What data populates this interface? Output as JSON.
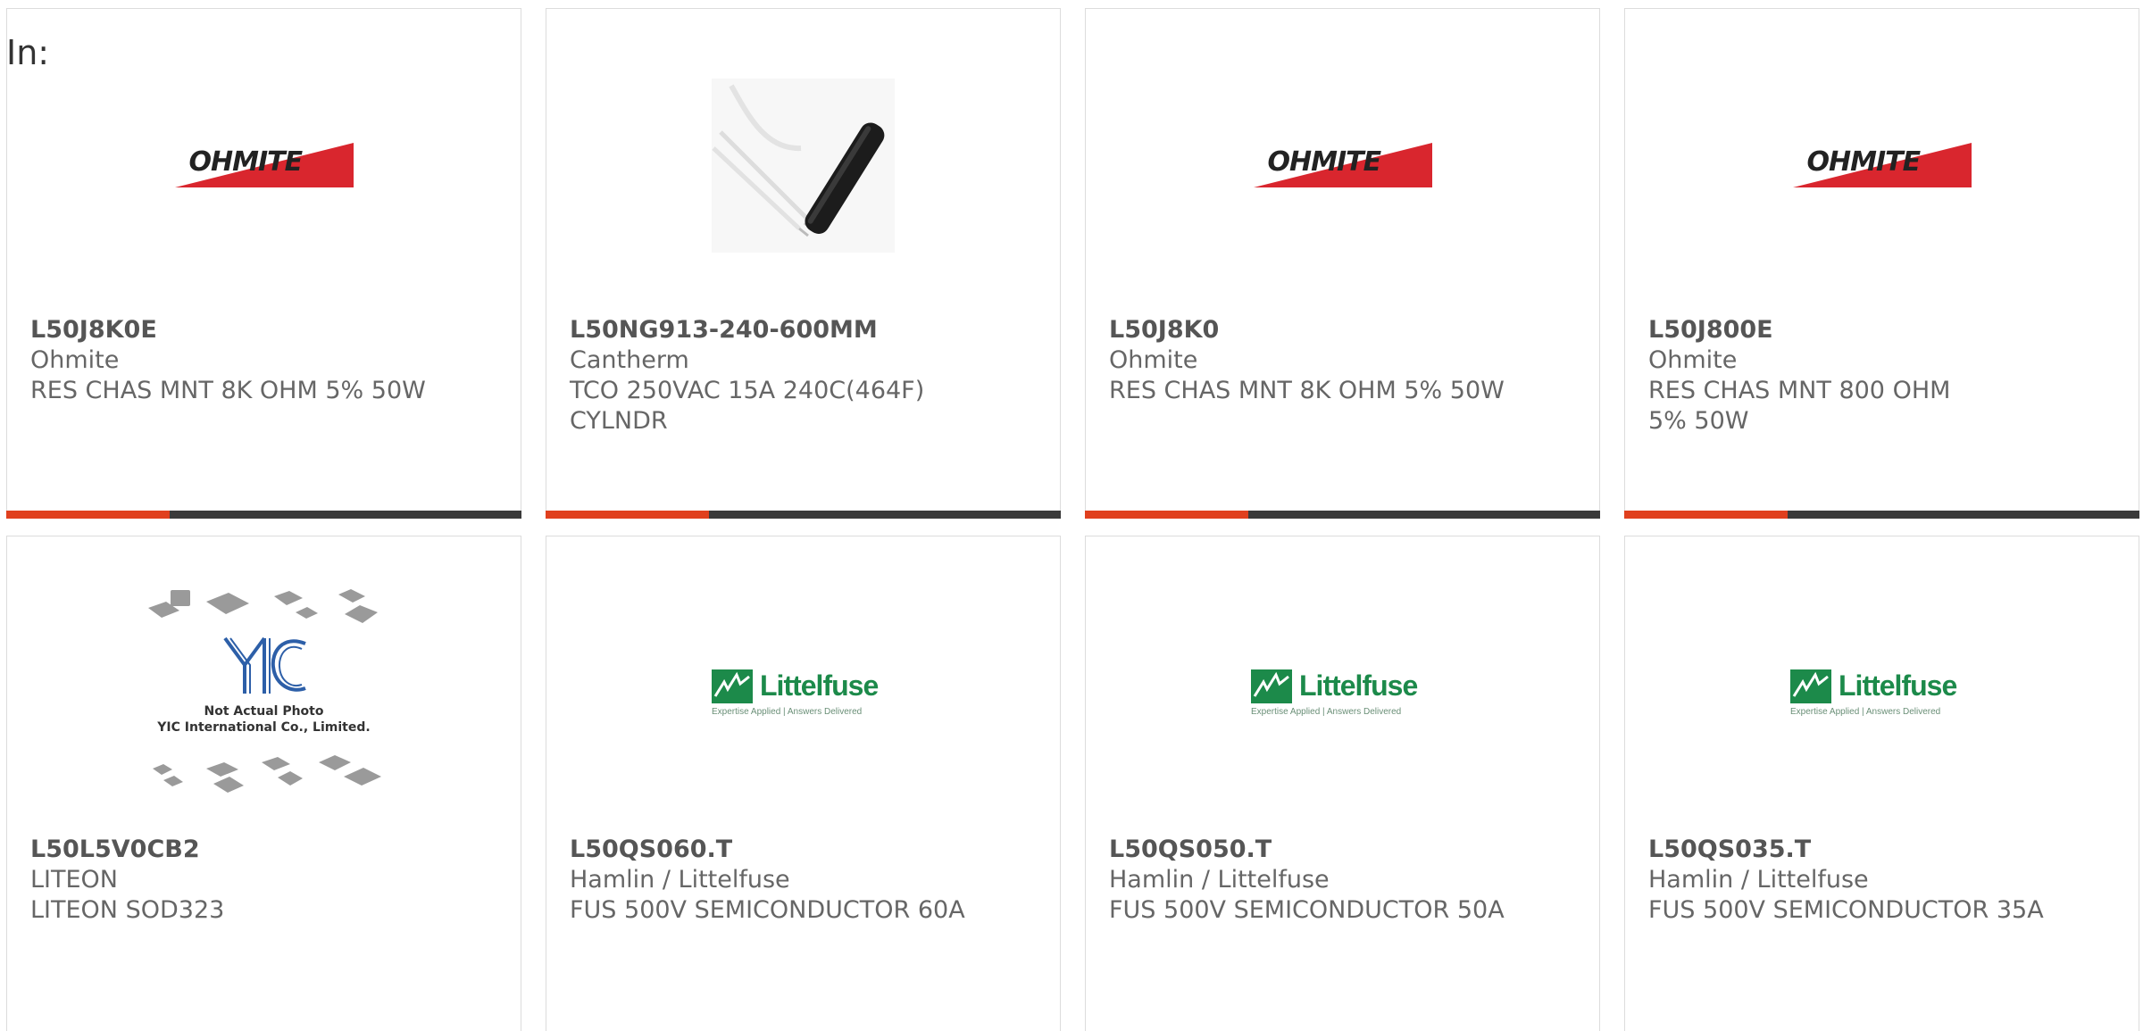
{
  "header": {
    "in_label": "In:"
  },
  "colors": {
    "accent": "#e0401e",
    "bar": "#3a3a3a",
    "ohmite_red": "#d9262e",
    "littelfuse_green": "#1c8a4a"
  },
  "products": [
    {
      "part_number": "L50J8K0E",
      "manufacturer": "Ohmite",
      "description": "RES CHAS MNT 8K OHM 5% 50W",
      "image": "ohmite-logo"
    },
    {
      "part_number": "L50NG913-240-600MM",
      "manufacturer": "Cantherm",
      "description": "TCO 250VAC 15A 240C(464F) CYLNDR",
      "image": "cylindrical-thermal-cutoff-photo"
    },
    {
      "part_number": "L50J8K0",
      "manufacturer": "Ohmite",
      "description": "RES CHAS MNT 8K OHM 5% 50W",
      "image": "ohmite-logo"
    },
    {
      "part_number": "L50J800E",
      "manufacturer": "Ohmite",
      "description": "RES CHAS MNT 800 OHM 5% 50W",
      "image": "ohmite-logo"
    },
    {
      "part_number": "L50L5V0CB2",
      "manufacturer": "LITEON",
      "description": "LITEON SOD323",
      "image": "yic-not-actual-photo"
    },
    {
      "part_number": "L50QS060.T",
      "manufacturer": "Hamlin / Littelfuse",
      "description": "FUS 500V SEMICONDUCTOR 60A",
      "image": "littelfuse-logo"
    },
    {
      "part_number": "L50QS050.T",
      "manufacturer": "Hamlin / Littelfuse",
      "description": "FUS 500V SEMICONDUCTOR 50A",
      "image": "littelfuse-logo"
    },
    {
      "part_number": "L50QS035.T",
      "manufacturer": "Hamlin / Littelfuse",
      "description": "FUS 500V SEMICONDUCTOR 35A",
      "image": "littelfuse-logo"
    }
  ],
  "logos": {
    "ohmite": "OHMITE",
    "littelfuse_name": "Littelfuse",
    "littelfuse_tagline": "Expertise Applied | Answers Delivered",
    "yic_line1": "Not Actual Photo",
    "yic_line2": "YIC International Co., Limited."
  }
}
